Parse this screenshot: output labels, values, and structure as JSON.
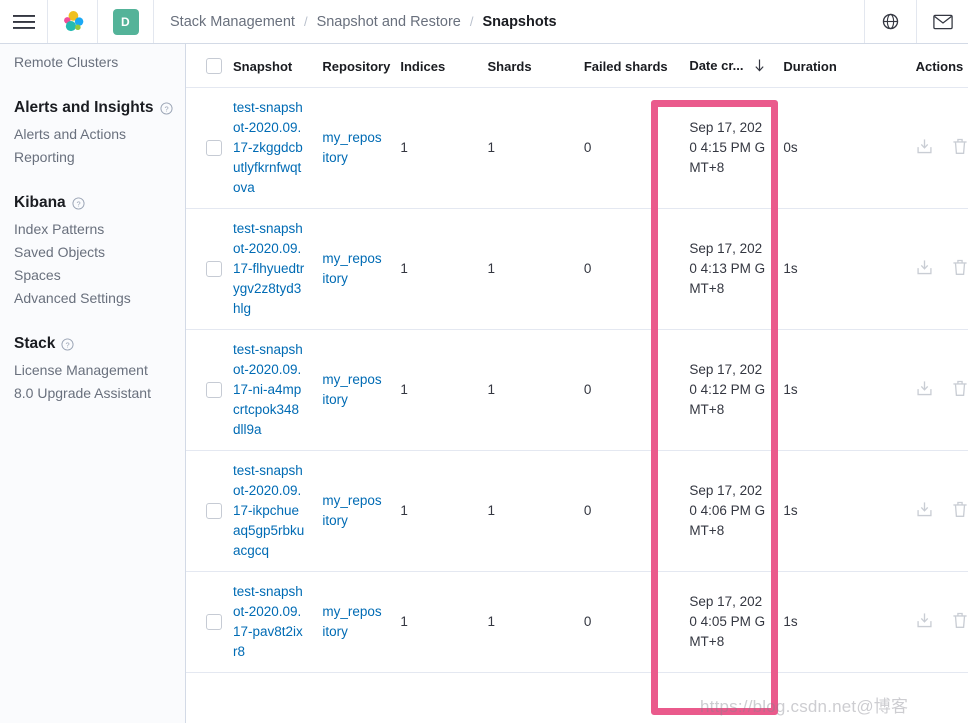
{
  "header": {
    "menu_icon": "hamburger-menu-icon",
    "logo_icon": "elastic-logo-icon",
    "space_badge": "D",
    "breadcrumbs": [
      {
        "label": "Stack Management",
        "active": false
      },
      {
        "label": "Snapshot and Restore",
        "active": false
      },
      {
        "label": "Snapshots",
        "active": true
      }
    ],
    "separator": "/",
    "right_icons": [
      {
        "name": "help-globe-icon",
        "glyph": "globe"
      },
      {
        "name": "mail-icon",
        "glyph": "envelope"
      }
    ]
  },
  "sidebar": {
    "top_link": "Remote Clusters",
    "groups": [
      {
        "title": "Alerts and Insights",
        "help": "?",
        "items": [
          "Alerts and Actions",
          "Reporting"
        ]
      },
      {
        "title": "Kibana",
        "help": "?",
        "items": [
          "Index Patterns",
          "Saved Objects",
          "Spaces",
          "Advanced Settings"
        ]
      },
      {
        "title": "Stack",
        "help": "?",
        "items": [
          "License Management",
          "8.0 Upgrade Assistant"
        ]
      }
    ]
  },
  "table": {
    "columns": [
      "Snapshot",
      "Repository",
      "Indices",
      "Shards",
      "Failed shards",
      "Date cr...",
      "Duration",
      "Actions"
    ],
    "sorted_column": "Date cr...",
    "sort_direction": "desc",
    "rows": [
      {
        "snapshot": "test-snapshot-2020.09.17-zkggdcbutlyfkrnfwqtova",
        "repository": "my_repository",
        "indices": "1",
        "shards": "1",
        "failed_shards": "0",
        "date_created": "Sep 17, 2020 4:15 PM GMT+8",
        "duration": "0s"
      },
      {
        "snapshot": "test-snapshot-2020.09.17-flhyuedtrygv2z8tyd3hlg",
        "repository": "my_repository",
        "indices": "1",
        "shards": "1",
        "failed_shards": "0",
        "date_created": "Sep 17, 2020 4:13 PM GMT+8",
        "duration": "1s"
      },
      {
        "snapshot": "test-snapshot-2020.09.17-ni-a4mpcrtcpok348dll9a",
        "repository": "my_repository",
        "indices": "1",
        "shards": "1",
        "failed_shards": "0",
        "date_created": "Sep 17, 2020 4:12 PM GMT+8",
        "duration": "1s"
      },
      {
        "snapshot": "test-snapshot-2020.09.17-ikpchueaq5gp5rbkuacgcq",
        "repository": "my_repository",
        "indices": "1",
        "shards": "1",
        "failed_shards": "0",
        "date_created": "Sep 17, 2020 4:06 PM GMT+8",
        "duration": "1s"
      },
      {
        "snapshot": "test-snapshot-2020.09.17-pav8t2ixr8",
        "repository": "my_repository",
        "indices": "1",
        "shards": "1",
        "failed_shards": "0",
        "date_created": "Sep 17, 2020 4:05 PM GMT+8",
        "duration": "1s"
      }
    ],
    "row_actions": [
      {
        "name": "restore-snapshot-icon",
        "label": "Restore"
      },
      {
        "name": "delete-snapshot-icon",
        "label": "Delete"
      }
    ]
  },
  "annotation": {
    "name": "date-created-highlight-box",
    "color": "#ea5a8c"
  },
  "watermark": {
    "text": "https://blog.csdn.net@博客"
  },
  "colors": {
    "accent_link": "#006bb4",
    "badge": "#54b399",
    "annotation": "#ea5a8c",
    "sidebar_bg": "#fafbfd"
  }
}
